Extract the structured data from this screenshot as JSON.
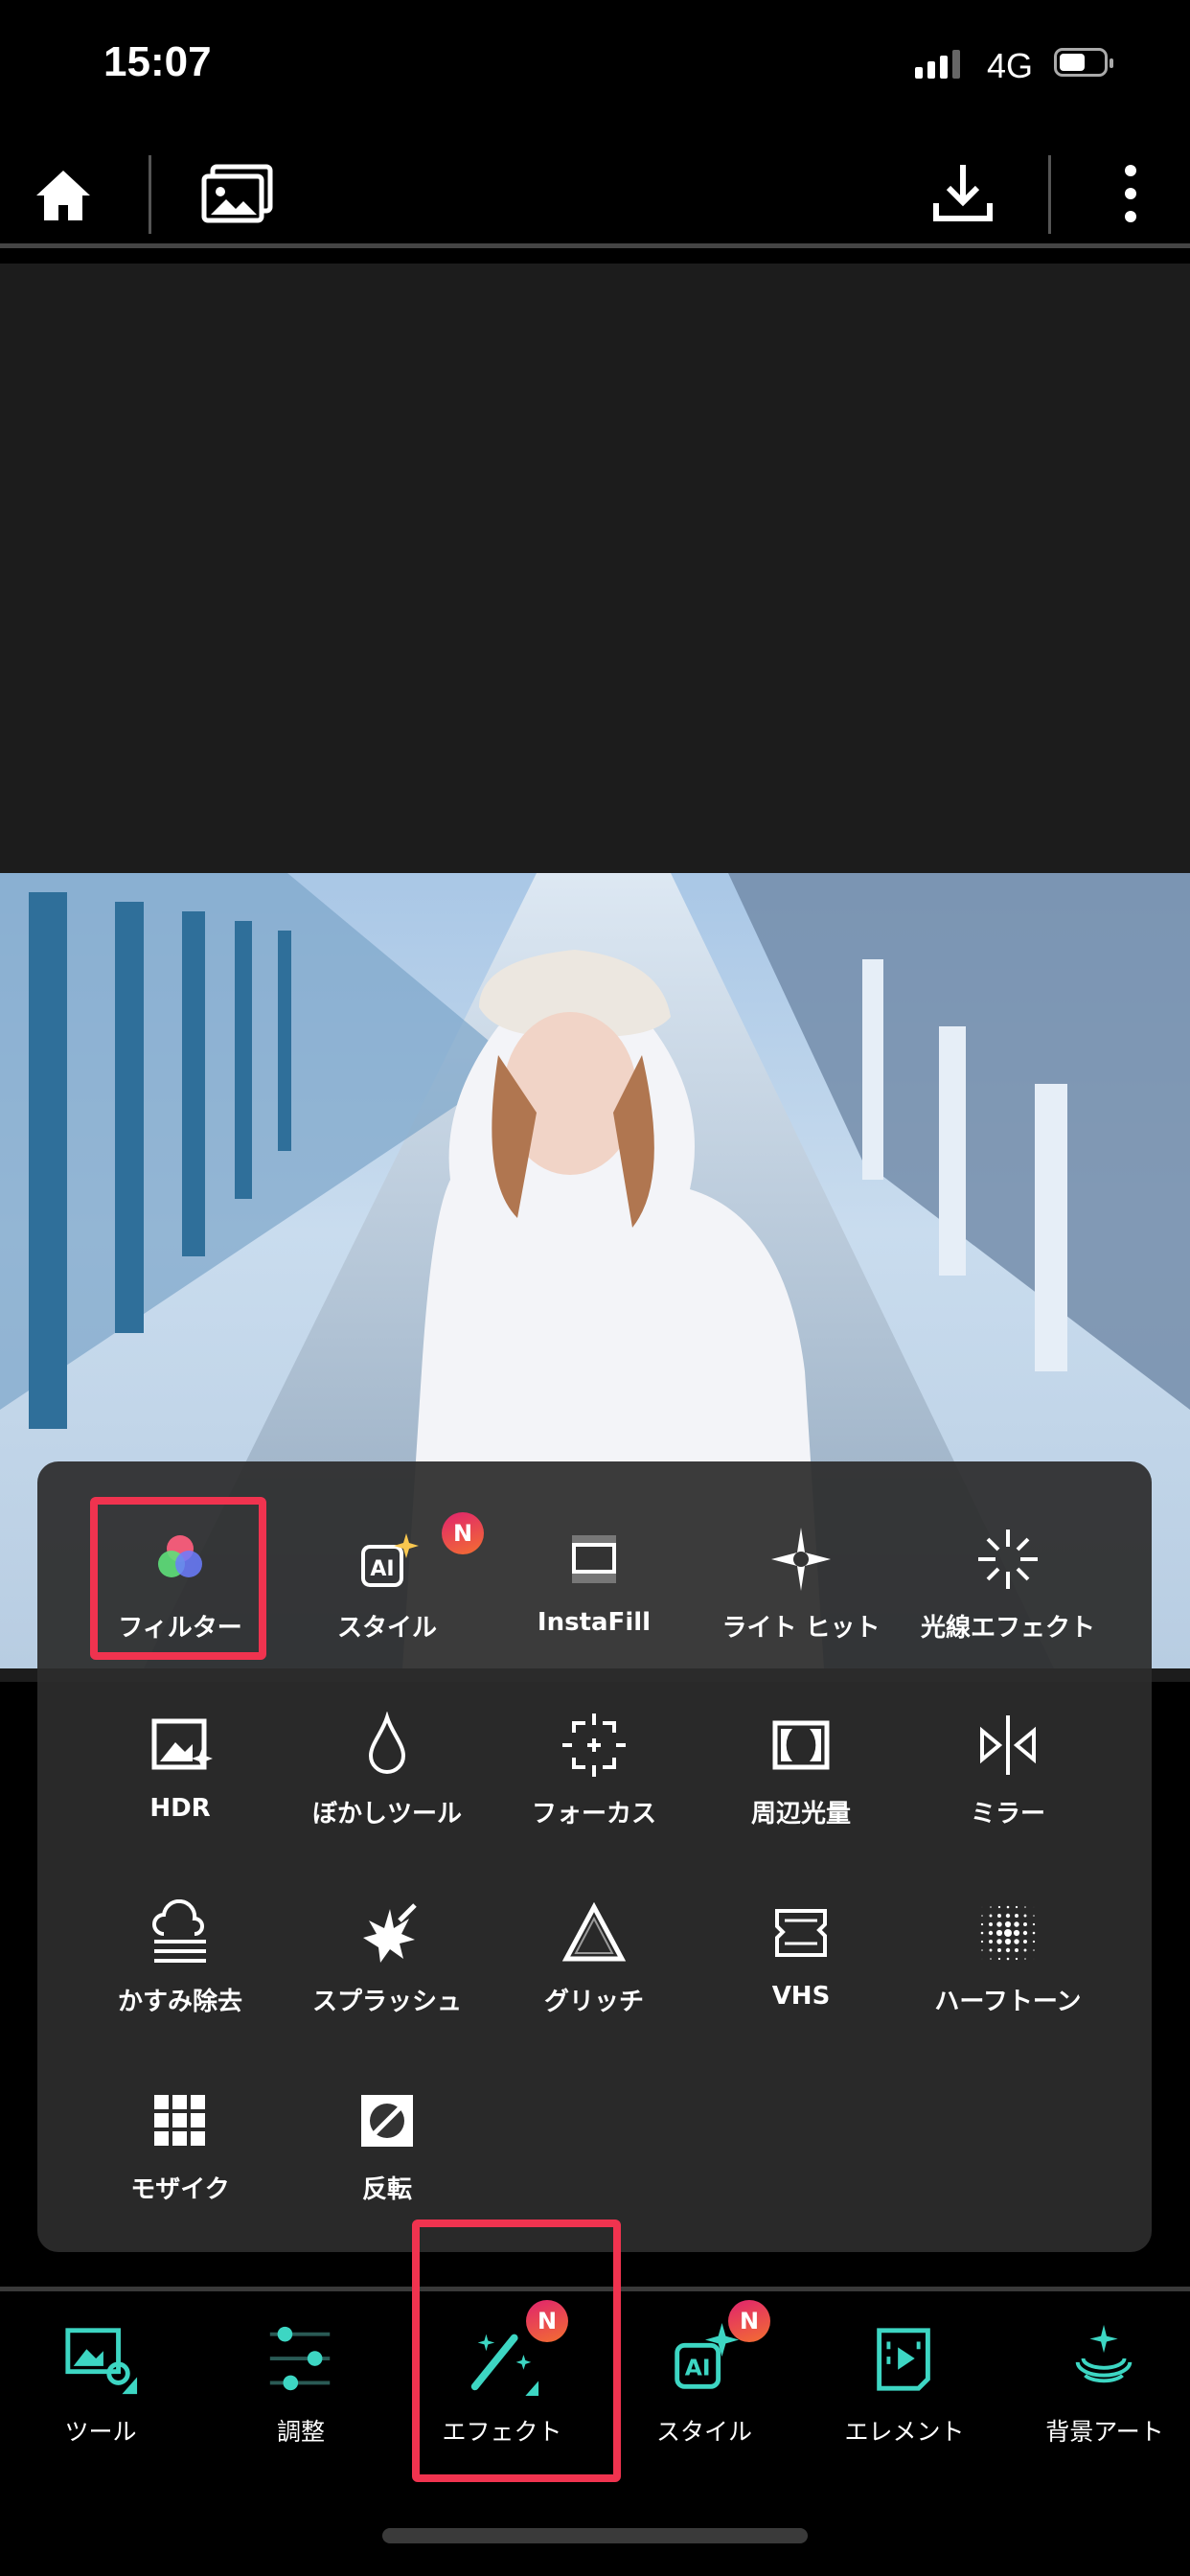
{
  "status_bar": {
    "time": "15:07",
    "network": "4G",
    "signal_bars": 3,
    "battery_percent": 60
  },
  "toolbar": {
    "home": "home-icon",
    "gallery": "gallery-icon",
    "download": "download-icon",
    "more": "more-icon"
  },
  "panel": {
    "items": [
      {
        "label": "フィルター",
        "icon": "filter-icon",
        "highlighted": true
      },
      {
        "label": "スタイル",
        "icon": "ai-style-icon",
        "badge": "N"
      },
      {
        "label": "InstaFill",
        "icon": "instafill-icon"
      },
      {
        "label": "ライト ヒット",
        "icon": "light-hit-icon"
      },
      {
        "label": "光線エフェクト",
        "icon": "light-ray-icon"
      },
      {
        "label": "HDR",
        "icon": "hdr-icon"
      },
      {
        "label": "ぼかしツール",
        "icon": "blur-icon"
      },
      {
        "label": "フォーカス",
        "icon": "focus-icon"
      },
      {
        "label": "周辺光量",
        "icon": "vignette-icon"
      },
      {
        "label": "ミラー",
        "icon": "mirror-icon"
      },
      {
        "label": "かすみ除去",
        "icon": "dehaze-icon"
      },
      {
        "label": "スプラッシュ",
        "icon": "splash-icon"
      },
      {
        "label": "グリッチ",
        "icon": "glitch-icon"
      },
      {
        "label": "VHS",
        "icon": "vhs-icon"
      },
      {
        "label": "ハーフトーン",
        "icon": "halftone-icon"
      },
      {
        "label": "モザイク",
        "icon": "mosaic-icon"
      },
      {
        "label": "反転",
        "icon": "invert-icon"
      }
    ]
  },
  "bottom_nav": {
    "items": [
      {
        "label": "ツール",
        "icon": "tools-icon"
      },
      {
        "label": "調整",
        "icon": "adjust-icon"
      },
      {
        "label": "エフェクト",
        "icon": "effect-wand-icon",
        "badge": "N",
        "active": true
      },
      {
        "label": "スタイル",
        "icon": "ai-style-icon",
        "badge": "N"
      },
      {
        "label": "エレメント",
        "icon": "element-icon"
      },
      {
        "label": "背景アート",
        "icon": "background-art-icon"
      }
    ]
  },
  "colors": {
    "accent": "#3dd6c3",
    "highlight": "#f0334f",
    "panel": "#2c2c2c"
  }
}
